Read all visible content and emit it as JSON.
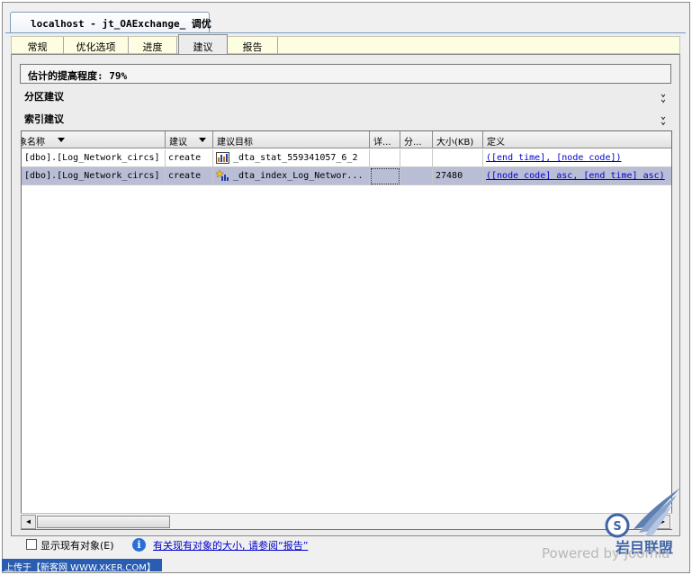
{
  "window": {
    "doc_tab_title": "localhost - jt_OAExchange_ 调优"
  },
  "tabs": [
    {
      "label": "常规",
      "active": false
    },
    {
      "label": "优化选项",
      "active": false
    },
    {
      "label": "进度",
      "active": false
    },
    {
      "label": "建议",
      "active": true
    },
    {
      "label": "报告",
      "active": false
    }
  ],
  "estimate_text": "估计的提高程度: 79%",
  "sections": {
    "partition": "分区建议",
    "index": "索引建议"
  },
  "grid": {
    "columns": [
      "象名称",
      "建议",
      "建议目标",
      "详...",
      "分...",
      "大小(KB)",
      "定义"
    ],
    "rows": [
      {
        "object": "[dbo].[Log_Network_circs]",
        "recommendation": "create",
        "target_icon": "statistics-icon",
        "target": "_dta_stat_559341057_6_2",
        "details": "",
        "partition": "",
        "size": "",
        "definition": "([end time], [node code])",
        "selected": false
      },
      {
        "object": "[dbo].[Log_Network_circs]",
        "recommendation": "create",
        "target_icon": "index-icon",
        "target": "_dta_index_Log_Networ...",
        "details": "",
        "partition": "",
        "size": "27480",
        "definition": "([node code] asc, [end time] asc)",
        "selected": true
      }
    ]
  },
  "footer": {
    "show_existing_label": "显示现有对象(E)",
    "info_link": "有关现有对象的大小, 请参阅“报告”",
    "upload_text": "上传于【新客网 WWW.XKER.COM】",
    "powered_text": "Powered by Joomla",
    "logo_text": "岩目联盟"
  },
  "colors": {
    "selected_row": "#b9bdd6",
    "link": "#0000cc",
    "info_icon": "#2a6fd6",
    "upload_bar": "#2a5db0"
  }
}
